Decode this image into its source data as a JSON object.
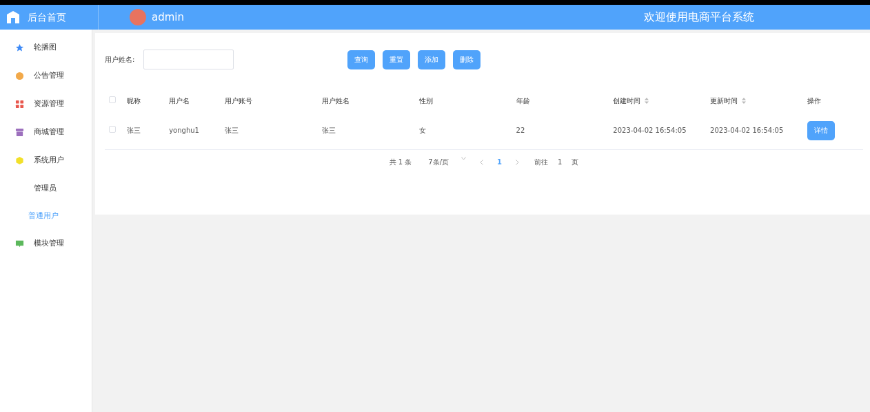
{
  "header": {
    "home_label": "后台首页",
    "user": "admin",
    "welcome": "欢迎使用电商平台系统"
  },
  "sidebar": {
    "items": [
      {
        "label": "轮播图",
        "color": "#3d8af7"
      },
      {
        "label": "公告管理",
        "color": "#f2a94a"
      },
      {
        "label": "资源管理",
        "color": "#e8574d"
      },
      {
        "label": "商城管理",
        "color": "#9c6fbd"
      },
      {
        "label": "系统用户",
        "color": "#f2e02a",
        "children": [
          {
            "label": "管理员",
            "selected": false
          },
          {
            "label": "普通用户",
            "selected": true
          }
        ]
      },
      {
        "label": "模块管理",
        "color": "#5cb85c"
      }
    ]
  },
  "search": {
    "label": "用户姓名:",
    "buttons": [
      "查询",
      "重置",
      "添加",
      "删除"
    ]
  },
  "table": {
    "columns": [
      {
        "label": "昵称",
        "sortable": false
      },
      {
        "label": "用户名",
        "sortable": false
      },
      {
        "label": "用户账号",
        "sortable": false
      },
      {
        "label": "用户姓名",
        "sortable": false
      },
      {
        "label": "性别",
        "sortable": false
      },
      {
        "label": "年龄",
        "sortable": false
      },
      {
        "label": "创建时间",
        "sortable": true
      },
      {
        "label": "更新时间",
        "sortable": true
      },
      {
        "label": "操作",
        "sortable": false
      }
    ],
    "all_checked": false,
    "rows": [
      {
        "checked": false,
        "cells": [
          "张三",
          "yonghu1",
          "张三",
          "张三",
          "女",
          "22",
          "2023-04-02 16:54:05",
          "2023-04-02 16:54:05"
        ],
        "action": "详情"
      }
    ]
  },
  "pagination": {
    "total": "共 1 条",
    "page_size": "7条/页",
    "pages": [
      {
        "label": "1",
        "selected": true
      }
    ],
    "goto_label": "前往",
    "goto_value": "1",
    "page_unit": "页"
  }
}
